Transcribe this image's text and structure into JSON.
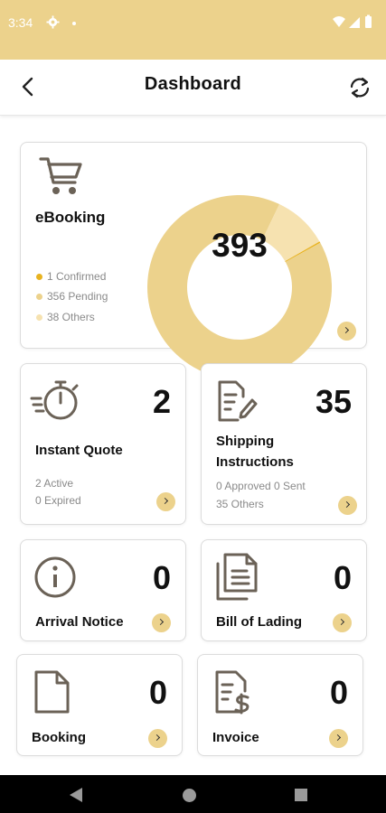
{
  "status_bar": {
    "time": "3:34",
    "icons": [
      "gear-icon",
      "wifi-icon",
      "signal-icon",
      "battery-icon"
    ]
  },
  "appbar": {
    "title": "Dashboard",
    "back_icon": "chevron-left-icon",
    "refresh_icon": "refresh-icon"
  },
  "colors": {
    "accent": "#ecd28c",
    "confirmed": "#e8b321",
    "pending": "#ecd28c",
    "others": "#f6e2b0",
    "muted": "#8a8a8a"
  },
  "ebooking": {
    "title": "eBooking",
    "total": "393",
    "legend": [
      {
        "label": "1 Confirmed",
        "value": 1
      },
      {
        "label": "356 Pending",
        "value": 356
      },
      {
        "label": "38 Others",
        "value": 38
      }
    ]
  },
  "cards": {
    "instant_quote": {
      "title": "Instant Quote",
      "count": "2",
      "line1": "2 Active",
      "line2": "0 Expired"
    },
    "shipping_instructions": {
      "title_line1": "Shipping",
      "title_line2": "Instructions",
      "count": "35",
      "line1": "0 Approved 0 Sent",
      "line2": "35 Others"
    },
    "arrival_notice": {
      "title": "Arrival Notice",
      "count": "0"
    },
    "bill_of_lading": {
      "title": "Bill of Lading",
      "count": "0"
    },
    "booking": {
      "title": "Booking",
      "count": "0"
    },
    "invoice": {
      "title": "Invoice",
      "count": "0"
    }
  }
}
